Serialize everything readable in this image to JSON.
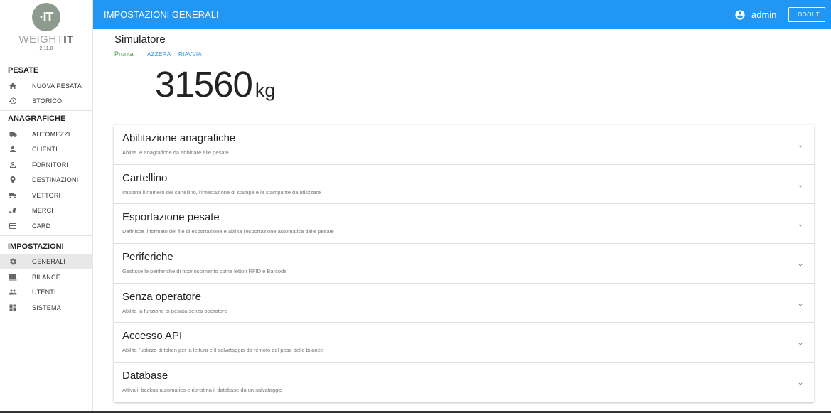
{
  "brand": {
    "logo": "·IT",
    "name_light": "WEIGHT",
    "name_bold": "IT",
    "version": "2.11.0"
  },
  "sidebar": {
    "sections": [
      {
        "title": "PESATE",
        "items": [
          {
            "label": "NUOVA PESATA",
            "icon": "home-icon"
          },
          {
            "label": "STORICO",
            "icon": "history-icon"
          }
        ]
      },
      {
        "title": "ANAGRAFICHE",
        "items": [
          {
            "label": "AUTOMEZZI",
            "icon": "truck-icon"
          },
          {
            "label": "CLIENTI",
            "icon": "person-icon"
          },
          {
            "label": "FORNITORI",
            "icon": "person-outline-icon"
          },
          {
            "label": "DESTINAZIONI",
            "icon": "location-pin-icon"
          },
          {
            "label": "VETTORI",
            "icon": "carrier-icon"
          },
          {
            "label": "MERCI",
            "icon": "goods-icon"
          },
          {
            "label": "CARD",
            "icon": "card-icon"
          }
        ]
      },
      {
        "title": "IMPOSTAZIONI",
        "items": [
          {
            "label": "GENERALI",
            "icon": "gear-icon",
            "active": true
          },
          {
            "label": "BILANCE",
            "icon": "scale-icon"
          },
          {
            "label": "UTENTI",
            "icon": "users-icon"
          },
          {
            "label": "SISTEMA",
            "icon": "grid-icon"
          }
        ]
      }
    ]
  },
  "topbar": {
    "title": "IMPOSTAZIONI GENERALI",
    "user": "admin",
    "logout": "LOGOUT"
  },
  "simulator": {
    "title": "Simulatore",
    "status": "Pronta",
    "reset": "AZZERA",
    "restart": "RIAVVIA",
    "weight": "31560",
    "unit": "kg"
  },
  "panels": [
    {
      "title": "Abilitazione anagrafiche",
      "desc": "Abilita le anagrafiche da abbinare alle pesate"
    },
    {
      "title": "Cartellino",
      "desc": "Imposta il numero del cartellino, l'intestazione di stampa e la stampante da utilizzare"
    },
    {
      "title": "Esportazione pesate",
      "desc": "Definisce il formato del file di esportazione e abilita l'esportazione automatica delle pesate"
    },
    {
      "title": "Periferiche",
      "desc": "Gestisce le periferiche di riconoscimento come lettori RFID e Barcode"
    },
    {
      "title": "Senza operatore",
      "desc": "Abilita la funzione di pesata senza operatore"
    },
    {
      "title": "Accesso API",
      "desc": "Abilita l'utilizzo di token per la lettura e il salvataggio da remoto del peso delle bilance"
    },
    {
      "title": "Database",
      "desc": "Attiva il backup automatico e ripristina il database da un salvataggio"
    }
  ],
  "colors": {
    "primary": "#2196f3",
    "status_ok": "#43a047",
    "logo": "#8d9a8e"
  }
}
